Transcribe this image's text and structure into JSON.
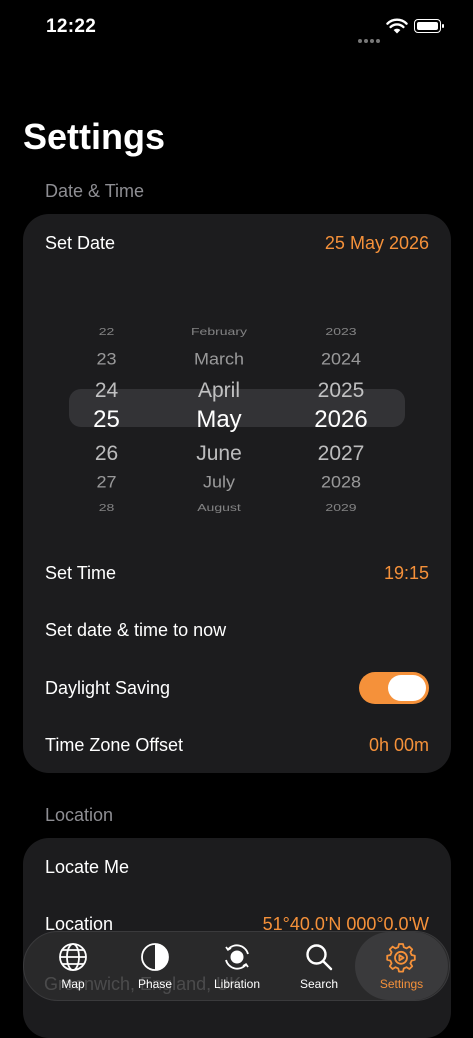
{
  "status_bar": {
    "time": "12:22"
  },
  "page_title": "Settings",
  "date_time": {
    "header": "Date & Time",
    "set_date_label": "Set Date",
    "set_date_value": "25 May 2026",
    "picker": {
      "days": [
        "22",
        "23",
        "24",
        "25",
        "26",
        "27",
        "28"
      ],
      "months": [
        "February",
        "March",
        "April",
        "May",
        "June",
        "July",
        "August"
      ],
      "years": [
        "2023",
        "2024",
        "2025",
        "2026",
        "2027",
        "2028",
        "2029"
      ]
    },
    "set_time_label": "Set Time",
    "set_time_value": "19:15",
    "now_label": "Set date & time to now",
    "daylight_label": "Daylight Saving",
    "daylight_on": true,
    "tz_label": "Time Zone Offset",
    "tz_value": "0h 00m"
  },
  "location": {
    "header": "Location",
    "locate_me_label": "Locate Me",
    "location_label": "Location",
    "location_value": "51°40.0'N 000°0.0'W"
  },
  "tab_bar": {
    "ghost_text": "Greenwich, England, UK",
    "tabs": [
      {
        "label": "Map",
        "icon": "globe-icon"
      },
      {
        "label": "Phase",
        "icon": "moon-phase-icon"
      },
      {
        "label": "Libration",
        "icon": "libration-icon"
      },
      {
        "label": "Search",
        "icon": "search-icon"
      },
      {
        "label": "Settings",
        "icon": "gear-icon",
        "active": true
      }
    ]
  },
  "colors": {
    "accent": "#f5913a",
    "card": "#1c1c1e",
    "secondary_text": "#8e8e93"
  }
}
